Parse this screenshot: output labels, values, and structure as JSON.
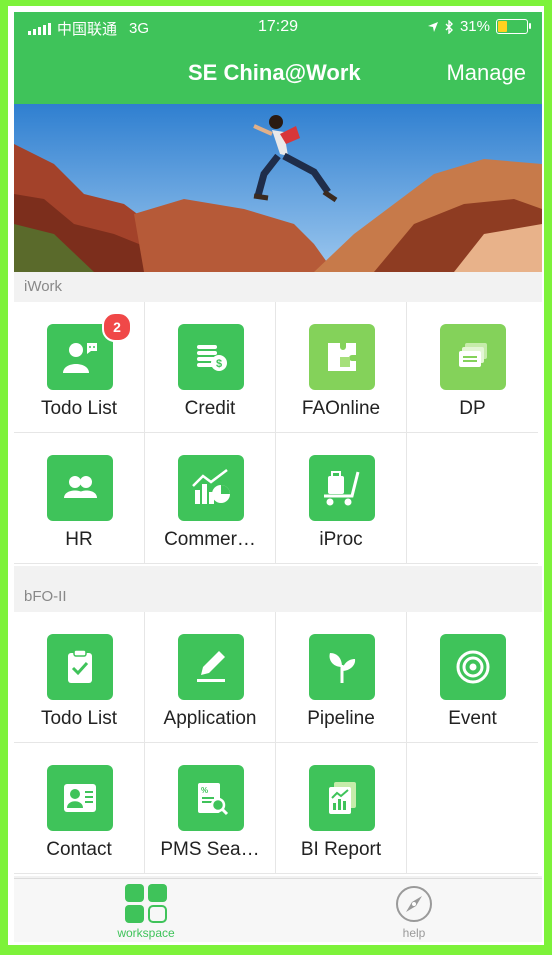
{
  "status": {
    "carrier": "中国联通",
    "network": "3G",
    "time": "17:29",
    "battery": "31%",
    "battery_level": 0.31
  },
  "header": {
    "title": "SE China@Work",
    "manage_label": "Manage"
  },
  "sections": [
    {
      "label": "iWork",
      "items": [
        {
          "label": "Todo List",
          "icon": "person-chat-icon",
          "badge": "2"
        },
        {
          "label": "Credit",
          "icon": "coins-icon"
        },
        {
          "label": "FAOnline",
          "icon": "puzzle-icon"
        },
        {
          "label": "DP",
          "icon": "stacked-cards-icon"
        },
        {
          "label": "HR",
          "icon": "people-icon"
        },
        {
          "label": "Commer…",
          "icon": "chart-icon"
        },
        {
          "label": "iProc",
          "icon": "cart-icon"
        }
      ]
    },
    {
      "label": "bFO-II",
      "items": [
        {
          "label": "Todo List",
          "icon": "clipboard-check-icon"
        },
        {
          "label": "Application",
          "icon": "pen-icon"
        },
        {
          "label": "Pipeline",
          "icon": "sprout-icon"
        },
        {
          "label": "Event",
          "icon": "target-icon"
        },
        {
          "label": "Contact",
          "icon": "contact-card-icon"
        },
        {
          "label": "PMS Sea…",
          "icon": "document-search-icon"
        },
        {
          "label": "BI Report",
          "icon": "report-icon"
        }
      ]
    }
  ],
  "tabs": [
    {
      "label": "workspace",
      "icon": "grid-icon",
      "active": true
    },
    {
      "label": "help",
      "icon": "compass-icon",
      "active": false
    }
  ],
  "colors": {
    "brand": "#3fc35a",
    "badge": "#f04848",
    "frame": "#7df23a"
  }
}
